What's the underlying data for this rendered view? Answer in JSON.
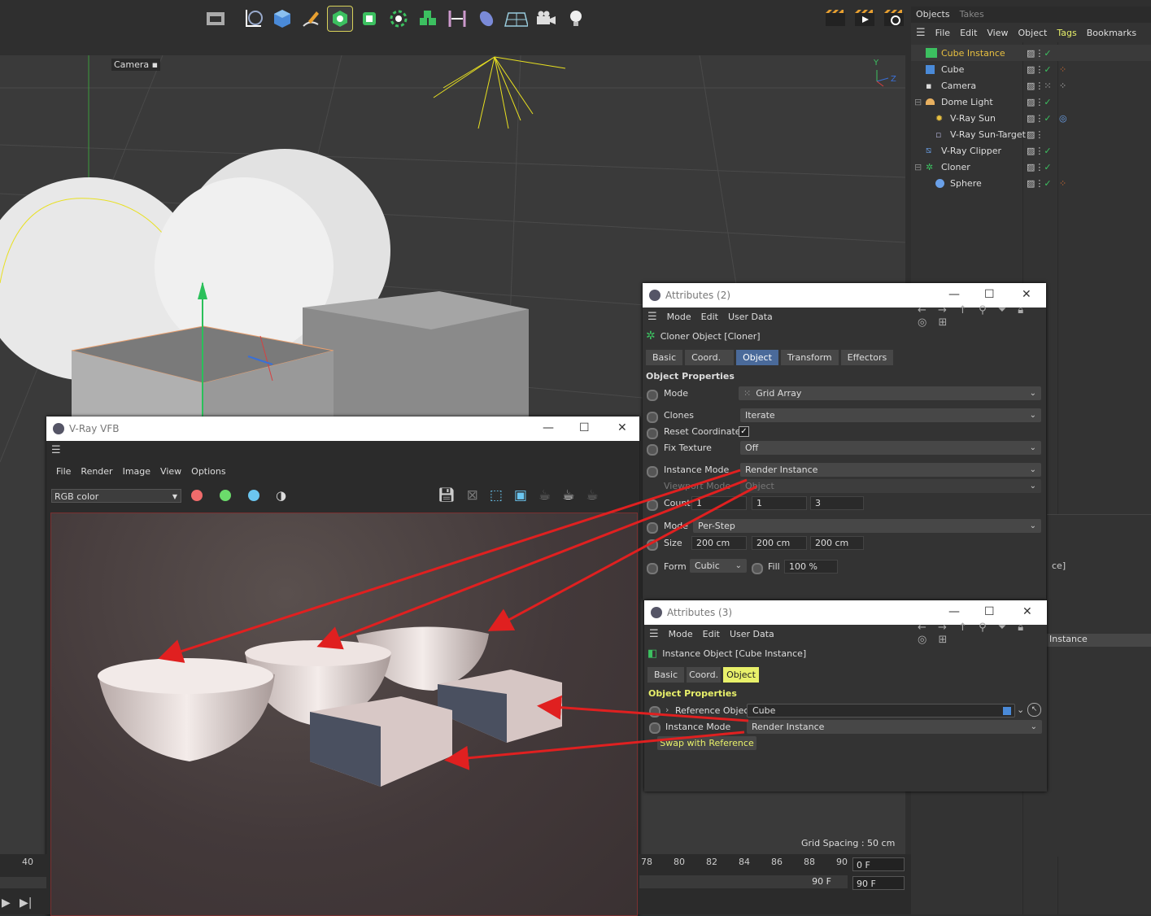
{
  "toolbar": {
    "buttons": [
      {
        "icon": "render-region-icon"
      },
      {
        "icon": "lpointer-icon"
      },
      {
        "icon": "cube-icon"
      },
      {
        "icon": "pen-icon"
      },
      {
        "icon": "generator-icon"
      },
      {
        "icon": "subdivision-icon"
      },
      {
        "icon": "cloner-icon"
      },
      {
        "icon": "mograph-icon"
      },
      {
        "icon": "deformer-icon"
      },
      {
        "icon": "field-icon"
      },
      {
        "icon": "floor-icon"
      },
      {
        "icon": "camera-icon"
      },
      {
        "icon": "light-icon"
      },
      {
        "icon": "render-view-icon"
      },
      {
        "icon": "render-picture-icon"
      },
      {
        "icon": "render-settings-icon"
      }
    ]
  },
  "viewport": {
    "camera_label": "Camera",
    "grid_spacing": "Grid Spacing : 50 cm",
    "axis_y": "Y",
    "axis_z": "Z"
  },
  "objects_panel": {
    "tabs": [
      "Objects",
      "Takes"
    ],
    "menu": [
      "File",
      "Edit",
      "View",
      "Object",
      "Tags",
      "Bookmarks"
    ],
    "items": [
      {
        "name": "Cube Instance",
        "highlight": true,
        "indent": 0
      },
      {
        "name": "Cube",
        "indent": 0
      },
      {
        "name": "Camera",
        "indent": 0
      },
      {
        "name": "Dome Light",
        "indent": 0
      },
      {
        "name": "V-Ray Sun",
        "indent": 1
      },
      {
        "name": "V-Ray Sun-Target",
        "indent": 1
      },
      {
        "name": "V-Ray Clipper",
        "indent": 0
      },
      {
        "name": "Cloner",
        "indent": 0
      },
      {
        "name": "Sphere",
        "indent": 1
      }
    ]
  },
  "attr2": {
    "title": "Attributes (2)",
    "menu": [
      "Mode",
      "Edit",
      "User Data"
    ],
    "object_name": "Cloner Object [Cloner]",
    "tabs": [
      "Basic",
      "Coord.",
      "Object",
      "Transform",
      "Effectors"
    ],
    "section": "Object Properties",
    "mode_label": "Mode",
    "mode_value": "Grid Array",
    "clones_label": "Clones",
    "clones_value": "Iterate",
    "reset_label": "Reset Coordinates",
    "fix_label": "Fix Texture",
    "fix_value": "Off",
    "instance_label": "Instance Mode",
    "instance_value": "Render Instance",
    "viewport_label": "Viewport Mode",
    "viewport_value": "Object",
    "count_label": "Count",
    "count": [
      "1",
      "1",
      "3"
    ],
    "mode2_label": "Mode",
    "mode2_value": "Per-Step",
    "size_label": "Size",
    "size": [
      "200 cm",
      "200 cm",
      "200 cm"
    ],
    "form_label": "Form",
    "form_value": "Cubic",
    "fill_label": "Fill",
    "fill_value": "100 %"
  },
  "attr3": {
    "title": "Attributes (3)",
    "menu": [
      "Mode",
      "Edit",
      "User Data"
    ],
    "object_name": "Instance Object [Cube Instance]",
    "tabs": [
      "Basic",
      "Coord.",
      "Object"
    ],
    "section": "Object Properties",
    "ref_label": "Reference Object",
    "ref_value": "Cube",
    "instance_label": "Instance Mode",
    "instance_value": "Render Instance",
    "swap_button": "Swap with Reference"
  },
  "behind_panel": {
    "partial_text1": "ce]",
    "partial_text2": "Instance"
  },
  "vfb": {
    "title": "V-Ray VFB",
    "menu": [
      "File",
      "Render",
      "Image",
      "View",
      "Options"
    ],
    "channel": "RGB color",
    "swatches": [
      "#f06b6b",
      "#6bdc6b",
      "#6bc6f0"
    ]
  },
  "timeline": {
    "left_tick": "40",
    "ticks": [
      "78",
      "80",
      "82",
      "84",
      "86",
      "88",
      "90"
    ],
    "current_frame": "0 F",
    "end_frame": "90 F",
    "end_frame2": "90 F"
  }
}
